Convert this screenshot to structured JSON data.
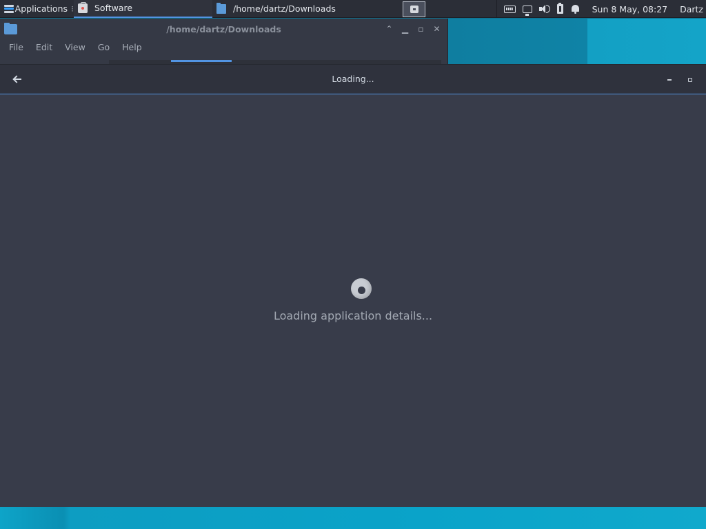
{
  "panel": {
    "apps_label": "Applications",
    "tasks": [
      {
        "label": "Software",
        "icon": "software-bag-icon",
        "active": true
      },
      {
        "label": "/home/dartz/Downloads",
        "icon": "folder-icon",
        "active": false
      }
    ],
    "clock": "Sun  8 May, 08:27",
    "user": "Dartz"
  },
  "file_manager": {
    "title": "/home/dartz/Downloads",
    "menu": [
      "File",
      "Edit",
      "View",
      "Go",
      "Help"
    ]
  },
  "software": {
    "header_title": "Loading...",
    "loading_message": "Loading application details..."
  },
  "colors": {
    "accent": "#5294e2",
    "window_bg": "#383c4a",
    "panel_bg": "#2b2e37"
  }
}
